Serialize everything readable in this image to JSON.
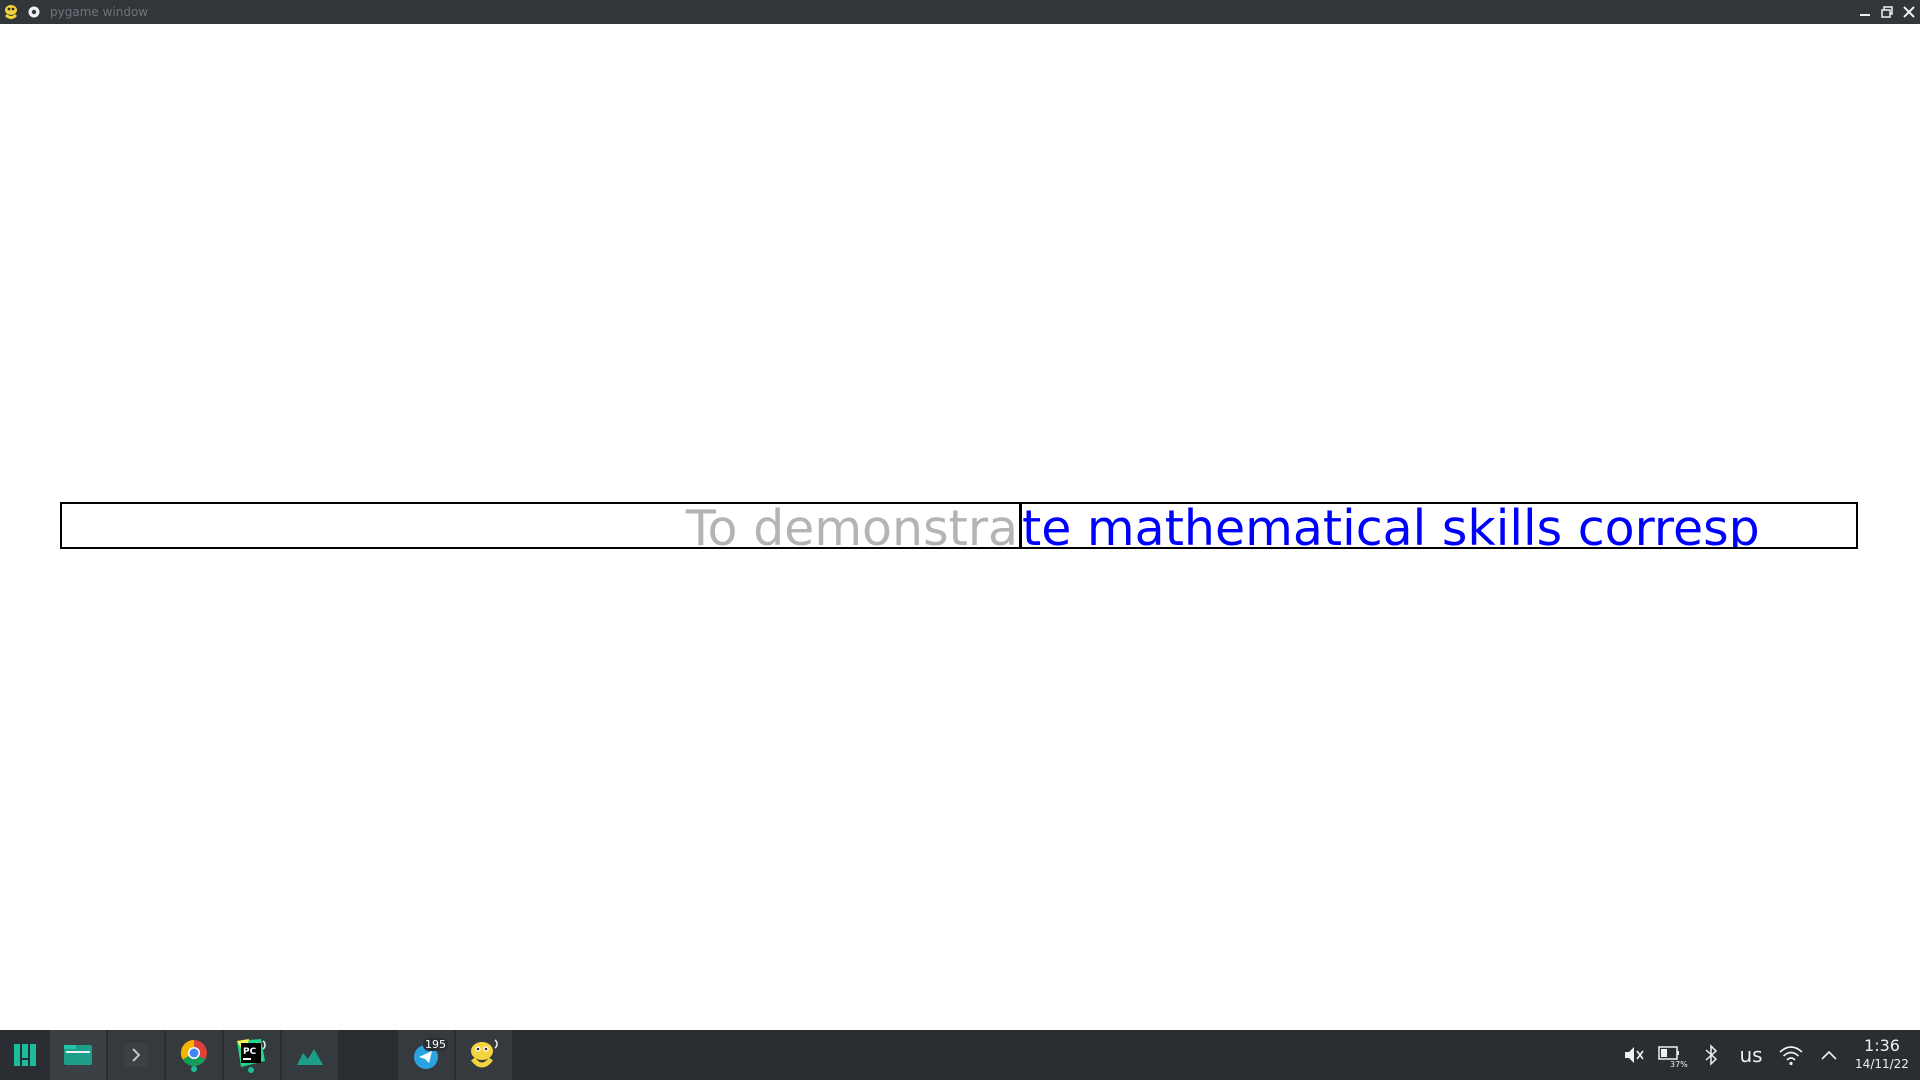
{
  "window": {
    "title": "pygame window"
  },
  "input": {
    "typed_text": "To demonstra",
    "remaining_text": "te mathematical skills corresp",
    "typed_color": "#b4b4b4",
    "remaining_color": "#0000ff"
  },
  "taskbar": {
    "apps": [
      {
        "name": "application-launcher"
      },
      {
        "name": "file-manager"
      },
      {
        "name": "terminal"
      },
      {
        "name": "chrome"
      },
      {
        "name": "pycharm"
      },
      {
        "name": "system-monitor"
      },
      {
        "name": "telegram",
        "badge": "195"
      },
      {
        "name": "pygame"
      }
    ],
    "tray": {
      "keyboard_layout": "us",
      "battery_percent": "37%",
      "time": "1:36",
      "date": "14/11/22"
    }
  },
  "colors": {
    "titlebar_bg": "#31363b",
    "taskbar_bg": "#2a2e32",
    "accent": "#1abc9c"
  }
}
